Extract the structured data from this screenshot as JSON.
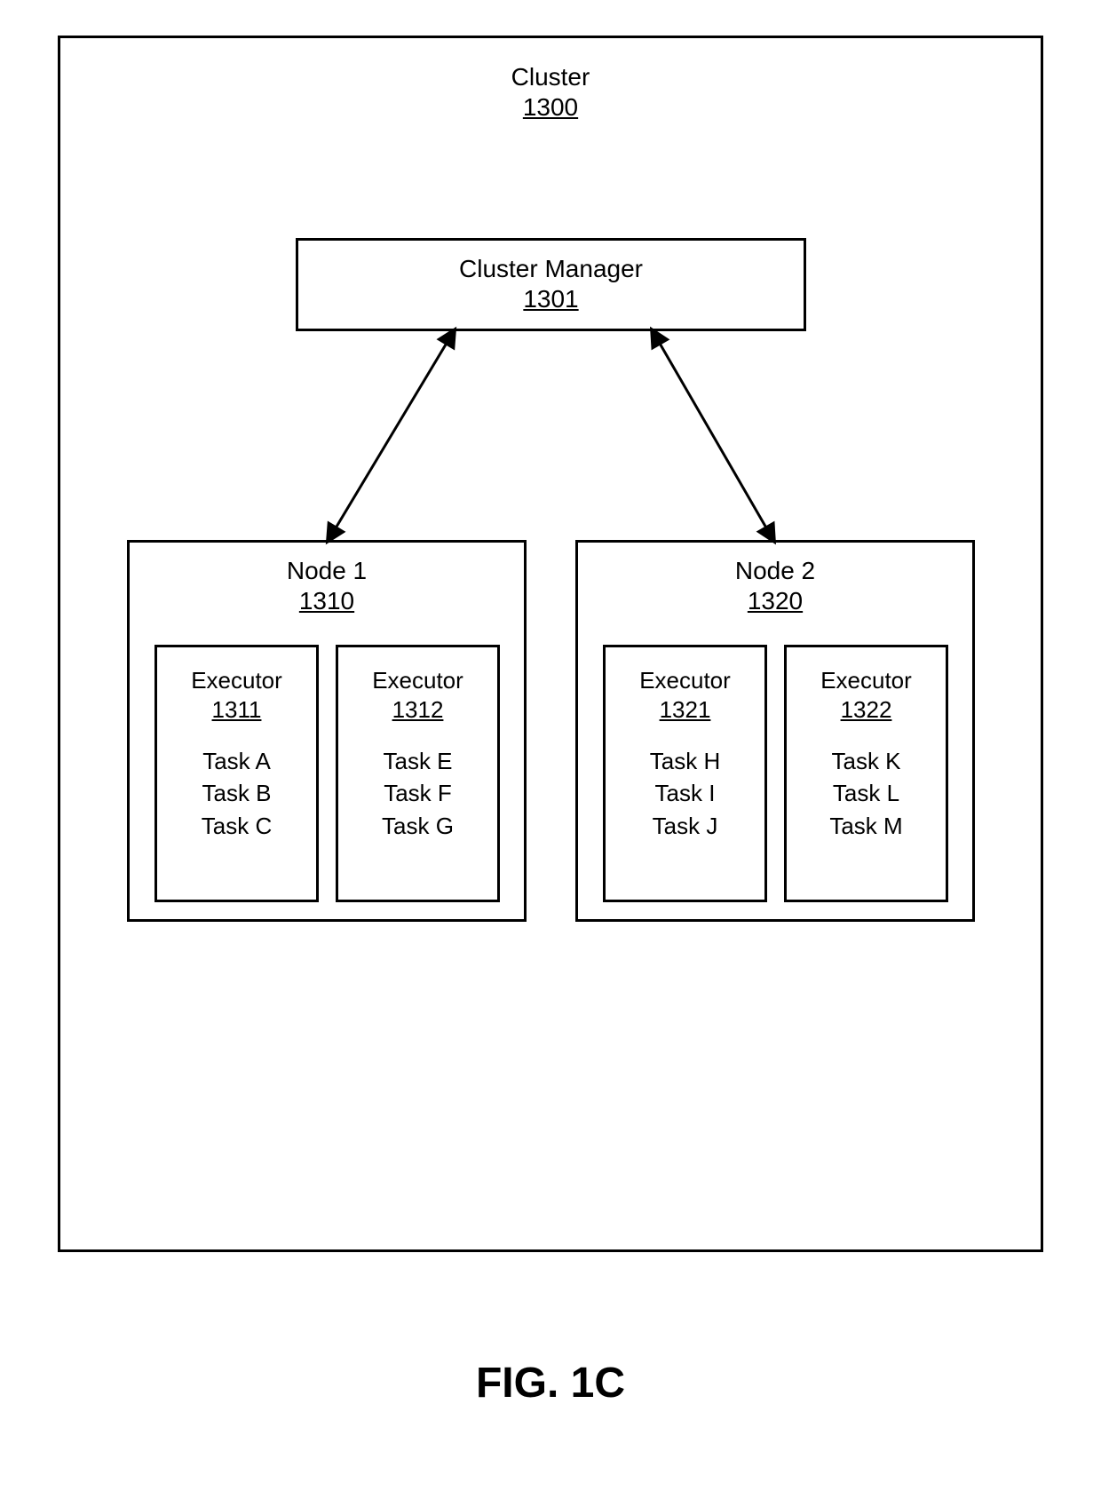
{
  "figure_label": "FIG. 1C",
  "cluster": {
    "title": "Cluster",
    "number": "1300"
  },
  "cluster_manager": {
    "title": "Cluster Manager",
    "number": "1301"
  },
  "nodes": [
    {
      "title": "Node 1",
      "number": "1310",
      "executors": [
        {
          "title": "Executor",
          "number": "1311",
          "tasks": [
            "Task A",
            "Task B",
            "Task C"
          ]
        },
        {
          "title": "Executor",
          "number": "1312",
          "tasks": [
            "Task E",
            "Task F",
            "Task G"
          ]
        }
      ]
    },
    {
      "title": "Node 2",
      "number": "1320",
      "executors": [
        {
          "title": "Executor",
          "number": "1321",
          "tasks": [
            "Task H",
            "Task I",
            "Task J"
          ]
        },
        {
          "title": "Executor",
          "number": "1322",
          "tasks": [
            "Task K",
            "Task L",
            "Task M"
          ]
        }
      ]
    }
  ]
}
